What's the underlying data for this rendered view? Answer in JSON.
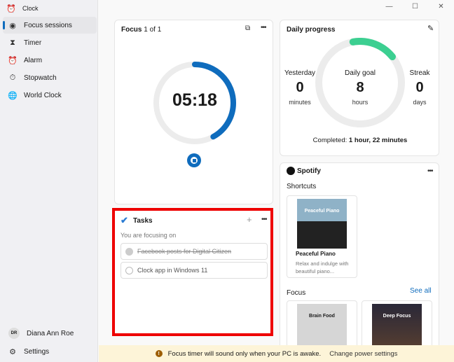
{
  "app": {
    "title": "Clock"
  },
  "window_controls": {
    "minimize": "—",
    "maximize": "☐",
    "close": "✕"
  },
  "sidebar": {
    "items": [
      {
        "label": "Focus sessions"
      },
      {
        "label": "Timer"
      },
      {
        "label": "Alarm"
      },
      {
        "label": "Stopwatch"
      },
      {
        "label": "World Clock"
      }
    ],
    "user": {
      "initials": "DR",
      "name": "Diana Ann Roe"
    },
    "settings": "Settings"
  },
  "focus": {
    "title": "Focus",
    "count": "1 of 1",
    "time": "05:18",
    "progress": 0.42
  },
  "tasks": {
    "title": "Tasks",
    "add": "+",
    "subtitle": "You are focusing on",
    "items": [
      {
        "label": "Facebook posts for Digital Citizen",
        "done": true
      },
      {
        "label": "Clock app in Windows 11",
        "done": false
      }
    ]
  },
  "daily": {
    "title": "Daily progress",
    "yesterday": {
      "label": "Yesterday",
      "value": "0",
      "unit": "minutes"
    },
    "goal": {
      "label": "Daily goal",
      "value": "8",
      "unit": "hours"
    },
    "streak": {
      "label": "Streak",
      "value": "0",
      "unit": "days"
    },
    "completed_label": "Completed:",
    "completed_value": "1 hour, 22 minutes",
    "progress": 0.17,
    "accent": "#3ccf91"
  },
  "spotify": {
    "brand": "Spotify",
    "shortcuts": "Shortcuts",
    "shortcut": {
      "cover": "Peaceful Piano",
      "title": "Peaceful Piano",
      "desc": "Relax and indulge with beautiful piano..."
    },
    "focus": "Focus",
    "see_all": "See all",
    "playlists": [
      {
        "cover": "Brain Food"
      },
      {
        "cover": "Deep Focus"
      }
    ]
  },
  "banner": {
    "message": "Focus timer will sound only when your PC is awake.",
    "link": "Change power settings",
    "icon": "!"
  }
}
